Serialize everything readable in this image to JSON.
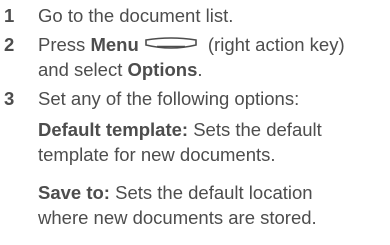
{
  "steps": [
    {
      "number": "1",
      "text": "Go to the document list."
    },
    {
      "number": "2",
      "pre": "Press ",
      "menu_label": "Menu",
      "key_icon": "action-key-icon",
      "post": " (right action key)",
      "line2_pre": "and select ",
      "options_label": "Options",
      "line2_post": "."
    },
    {
      "number": "3",
      "text": "Set any of the following options:"
    }
  ],
  "options": [
    {
      "label": "Default template:",
      "desc_line1": " Sets the default",
      "desc_line2": "template for new documents."
    },
    {
      "label": "Save to:",
      "desc_line1": " Sets the default location",
      "desc_line2": "where new documents are stored."
    }
  ]
}
